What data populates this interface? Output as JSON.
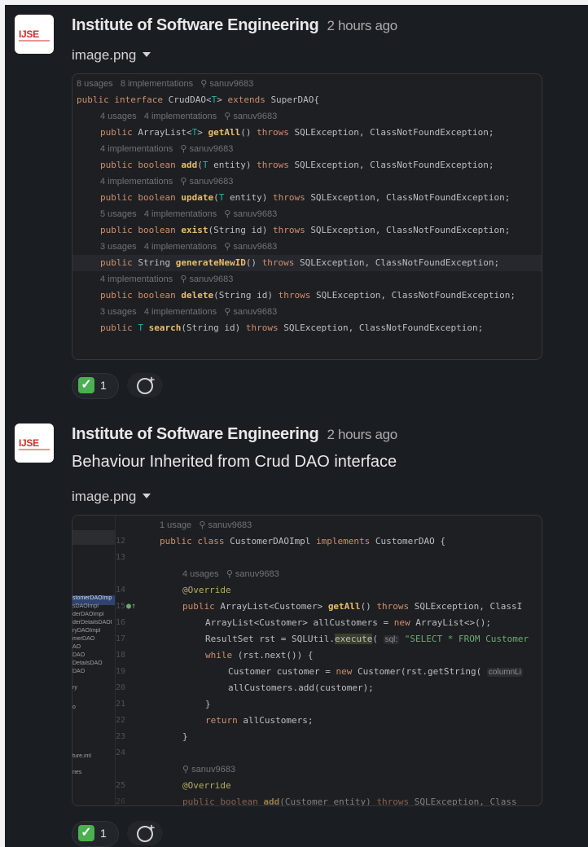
{
  "messages": [
    {
      "author": "Institute of Software Engineering",
      "time": "2 hours ago",
      "text": "",
      "avatar_text": "IJSE",
      "file_name": "image.png",
      "reaction_emoji": "✓",
      "reaction_count": "1"
    },
    {
      "author": "Institute of Software Engineering",
      "time": "2 hours ago",
      "text": "Behaviour Inherited from Crud DAO interface",
      "avatar_text": "IJSE",
      "file_name": "image.png",
      "reaction_emoji": "✓",
      "reaction_count": "1"
    }
  ],
  "code1": {
    "lines": [
      {
        "hint": "8 usages   8 implementations   ⚲ sanuv9683"
      },
      {
        "code": "public interface CrudDAO<T> extends SuperDAO{"
      },
      {
        "hint": "4 usages   4 implementations   ⚲ sanuv9683"
      },
      {
        "code": "public ArrayList<T> getAll() throws SQLException, ClassNotFoundException;"
      },
      {
        "hint": "4 implementations   ⚲ sanuv9683"
      },
      {
        "code": "public boolean add(T entity) throws SQLException, ClassNotFoundException;"
      },
      {
        "hint": "4 implementations   ⚲ sanuv9683"
      },
      {
        "code": "public boolean update(T entity) throws SQLException, ClassNotFoundException;"
      },
      {
        "hint": "5 usages   4 implementations   ⚲ sanuv9683"
      },
      {
        "code": "public boolean exist(String id) throws SQLException, ClassNotFoundException;"
      },
      {
        "hint": "3 usages   4 implementations   ⚲ sanuv9683"
      },
      {
        "code": "public String generateNewID() throws SQLException, ClassNotFoundException;"
      },
      {
        "hint": "4 implementations   ⚲ sanuv9683"
      },
      {
        "code": "public boolean delete(String id) throws SQLException, ClassNotFoundException;"
      },
      {
        "hint": "3 usages   4 implementations   ⚲ sanuv9683"
      },
      {
        "code": "public T search(String id) throws SQLException, ClassNotFoundException;"
      }
    ]
  },
  "code2": {
    "hint1": "1 usage   ⚲ sanuv9683",
    "hint2": "4 usages   ⚲ sanuv9683",
    "hint3": "⚲ sanuv9683",
    "line_numbers": [
      "12",
      "13",
      "14",
      "15",
      "16",
      "17",
      "18",
      "19",
      "20",
      "21",
      "22",
      "23",
      "24",
      "25",
      "26"
    ],
    "sidebar": [
      "stomerDAOImp",
      "sDAOImpl",
      "derDAOImpl",
      "derDetailsDAOI",
      "ryDAOImpl",
      "merDAO",
      "AO",
      "DAO",
      "DetailsDAO",
      "DAO",
      "",
      "ry",
      "",
      "o",
      "",
      "",
      "",
      "",
      "ture.iml",
      "",
      "ries"
    ]
  }
}
